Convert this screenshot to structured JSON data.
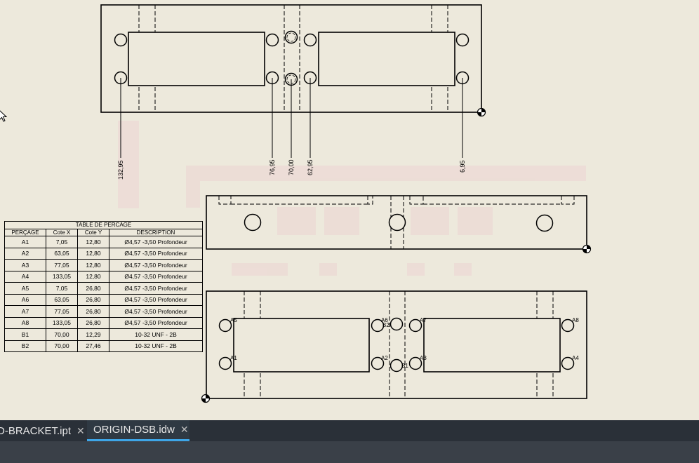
{
  "drawing": {
    "top_view_dims": [
      "132,95",
      "76,95",
      "70,00",
      "62,95",
      "6,95"
    ],
    "front_labels": {
      "top_left": "A5",
      "top_mid_left": "A6",
      "top_mid_b2": "B2",
      "top_mid_right": "A7",
      "top_right": "A8",
      "bot_left": "A1",
      "bot_mid_left": "A2",
      "bot_mid_b1": "B1",
      "bot_mid_right": "A3",
      "bot_right": "A4"
    }
  },
  "hole_table": {
    "title": "TABLE DE PERCAGE",
    "headers": [
      "PERÇAGE",
      "Cote X",
      "Cote Y",
      "DESCRIPTION"
    ],
    "rows": [
      [
        "A1",
        "7,05",
        "12,80",
        "Ø4,57 -3,50 Profondeur"
      ],
      [
        "A2",
        "63,05",
        "12,80",
        "Ø4,57 -3,50 Profondeur"
      ],
      [
        "A3",
        "77,05",
        "12,80",
        "Ø4,57 -3,50 Profondeur"
      ],
      [
        "A4",
        "133,05",
        "12,80",
        "Ø4,57 -3,50 Profondeur"
      ],
      [
        "A5",
        "7,05",
        "26,80",
        "Ø4,57 -3,50 Profondeur"
      ],
      [
        "A6",
        "63,05",
        "26,80",
        "Ø4,57 -3,50 Profondeur"
      ],
      [
        "A7",
        "77,05",
        "26,80",
        "Ø4,57 -3,50 Profondeur"
      ],
      [
        "A8",
        "133,05",
        "26,80",
        "Ø4,57 -3,50 Profondeur"
      ],
      [
        "B1",
        "70,00",
        "12,29",
        "10-32 UNF - 2B"
      ],
      [
        "B2",
        "70,00",
        "27,46",
        "10-32 UNF - 2B"
      ]
    ]
  },
  "tabs": [
    {
      "label": "D-BRACKET.ipt",
      "close": "✕",
      "active": false
    },
    {
      "label": "ORIGIN-DSB.idw",
      "close": "✕",
      "active": true
    }
  ],
  "colors": {
    "sheet": "#ede9dc",
    "tabbar": "#2a3038",
    "accent": "#3ea6e8"
  }
}
